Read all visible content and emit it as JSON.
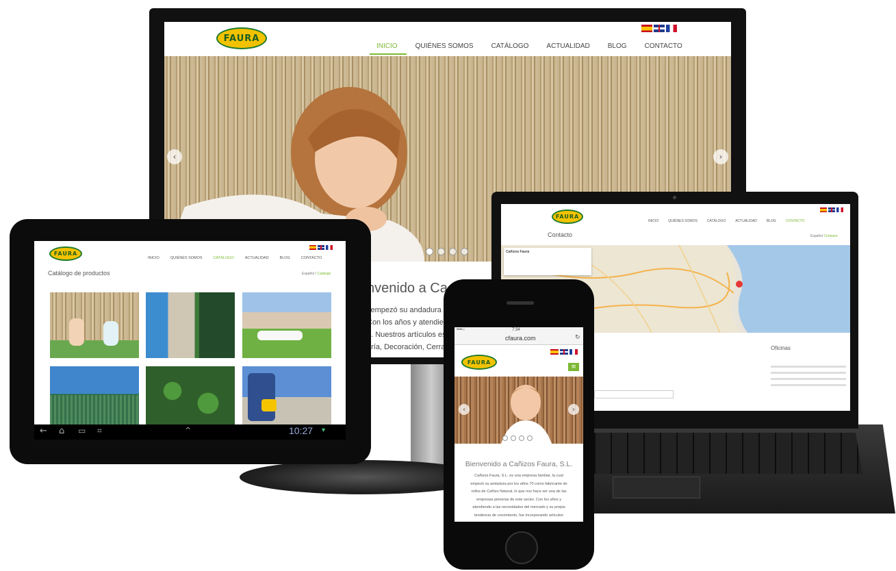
{
  "brand": {
    "logo_text": "FAURA",
    "accent": "#7cb833",
    "logo_yellow": "#f2c200",
    "logo_green": "#1f7a2e"
  },
  "monitor": {
    "nav": [
      {
        "label": "INICIO",
        "active": true
      },
      {
        "label": "QUIÉNES SOMOS",
        "active": false
      },
      {
        "label": "CATÁLOGO",
        "active": false
      },
      {
        "label": "ACTUALIDAD",
        "active": false
      },
      {
        "label": "BLOG",
        "active": false
      },
      {
        "label": "CONTACTO",
        "active": false
      }
    ],
    "welcome_heading": "nvenido a Ca",
    "body_lines": [
      "l empezó su andadura po",
      "Con los años y atendiendo",
      "o. Nuestros artículos está",
      "ería, Decoración, Cerram"
    ],
    "prev_icon": "chevron-left-icon",
    "next_icon": "chevron-right-icon"
  },
  "tablet": {
    "nav": [
      {
        "label": "INICIO",
        "active": false
      },
      {
        "label": "QUIÉNES SOMOS",
        "active": false
      },
      {
        "label": "CATÁLOGO",
        "active": true
      },
      {
        "label": "ACTUALIDAD",
        "active": false
      },
      {
        "label": "BLOG",
        "active": false
      },
      {
        "label": "CONTACTO",
        "active": false
      }
    ],
    "page_title": "Catálogo de productos",
    "breadcrumb_home": "Español",
    "breadcrumb_sep": "/",
    "breadcrumb_current": "Catálogo",
    "clock": "10:27"
  },
  "laptop": {
    "nav": [
      {
        "label": "INICIO",
        "active": false
      },
      {
        "label": "QUIÉNES SOMOS",
        "active": false
      },
      {
        "label": "CATÁLOGO",
        "active": false
      },
      {
        "label": "ACTUALIDAD",
        "active": false
      },
      {
        "label": "BLOG",
        "active": false
      },
      {
        "label": "CONTACTO",
        "active": true
      }
    ],
    "page_title": "Contacto",
    "breadcrumb_home": "Español",
    "breadcrumb_current": "Contacto",
    "map_card_title": "Cañizos Faura",
    "offices_heading": "Oficinas"
  },
  "phone": {
    "carrier": "••••○",
    "time": "7:34",
    "url": "cfaura.com",
    "welcome_heading": "Bienvenido a Cañizos Faura, S.L.",
    "body_lines": [
      "Cañizos Faura, S.L. es una empresa familiar, la cual",
      "empezó su andadura por los años 70 como fabricante de",
      "rollos de Cañizo Natural, lo que nos hace ser una de las",
      "empresas pioneras de este sector. Con los años y",
      "atendiendo a las necesidades del mercado y su propia",
      "tendencia de crecimiento, fue incorporando artículos"
    ]
  }
}
